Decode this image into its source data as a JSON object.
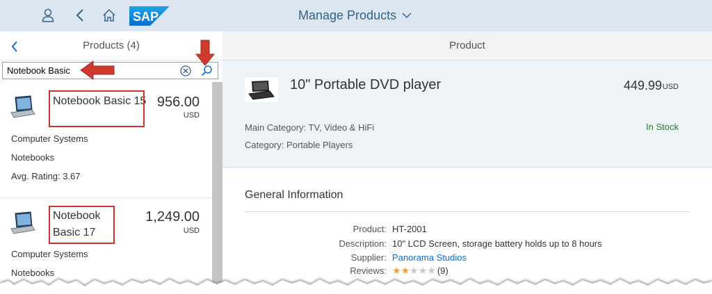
{
  "shell": {
    "title": "Manage Products",
    "icons": [
      "user-icon",
      "back-icon",
      "home-icon",
      "sap-logo",
      "chevron-down-icon"
    ],
    "logo_text": "SAP",
    "bg_color": "#dbe6f1"
  },
  "master": {
    "title": "Products (4)",
    "search": {
      "value": "Notebook Basic"
    },
    "items": [
      {
        "title": "Notebook Basic 15",
        "price": "956.00",
        "currency": "USD",
        "attributes": [
          "Computer Systems",
          "Notebooks",
          "Avg. Rating: 3.67"
        ]
      },
      {
        "title": "Notebook Basic 17",
        "price": "1,249.00",
        "currency": "USD",
        "attributes": [
          "Computer Systems",
          "Notebooks"
        ]
      }
    ]
  },
  "detail": {
    "header_title": "Product",
    "object": {
      "title": "10\" Portable DVD player",
      "price": "449.99",
      "currency": "USD",
      "main_category": "Main Category: TV, Video & HiFi",
      "category": "Category: Portable Players",
      "status": "In Stock",
      "status_color": "#2b7c2b"
    },
    "general_info": {
      "title": "General Information",
      "fields": [
        {
          "label": "Product:",
          "value": "HT-2001"
        },
        {
          "label": "Description:",
          "value": "10\" LCD Screen, storage battery holds up to 8 hours"
        },
        {
          "label": "Supplier:",
          "value": "Panorama Studios"
        },
        {
          "label": "Reviews:",
          "value": "(9)"
        }
      ],
      "rating": 2,
      "rating_max": 5
    }
  },
  "annotation_color": "#c7352b"
}
